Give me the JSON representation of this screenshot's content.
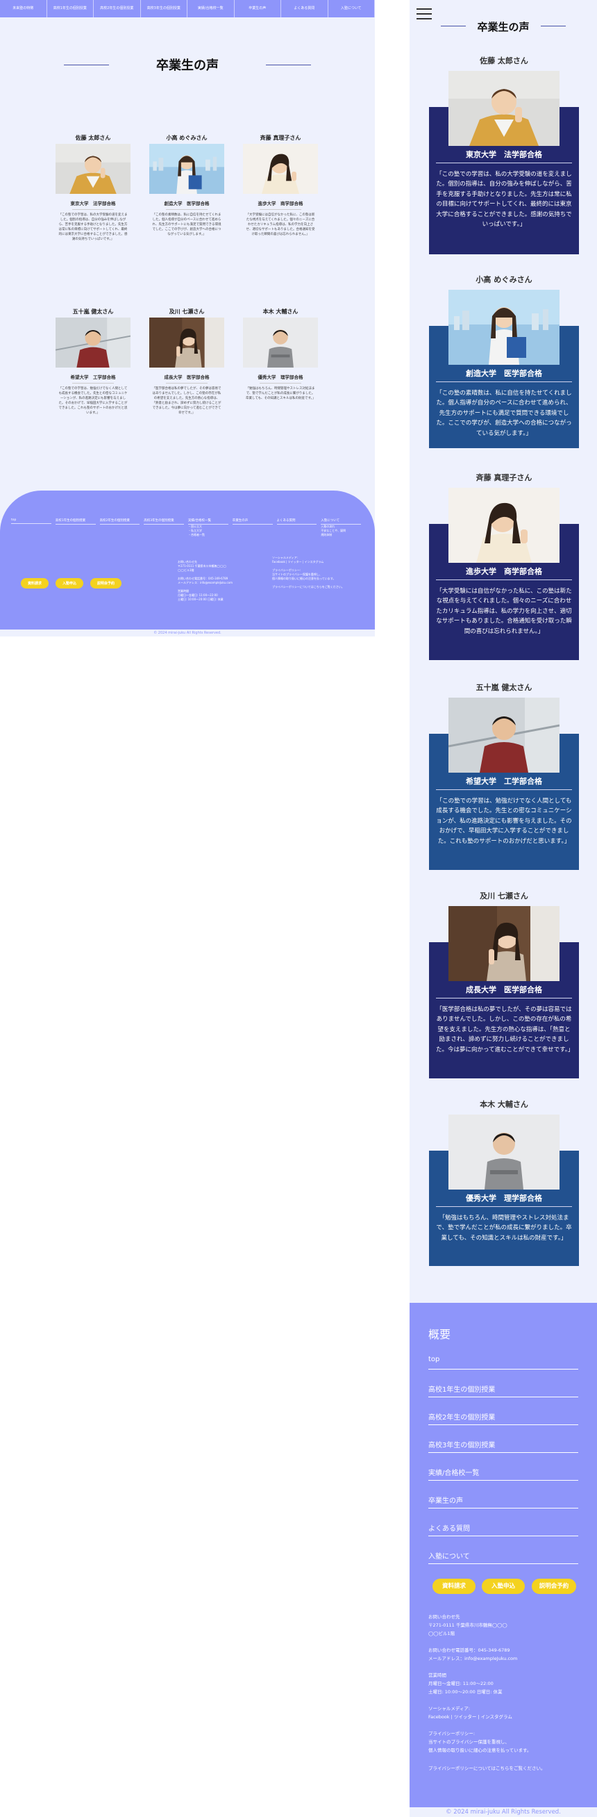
{
  "nav": {
    "items": [
      "未来塾の特徴",
      "高校1年生の個別授業",
      "高校2年生の個別授業",
      "高校3年生の個別授業",
      "実績/合格校一覧",
      "卒業生の声",
      "よくある質問",
      "入塾について"
    ]
  },
  "page_title": "卒業生の声",
  "testimonials": [
    {
      "name": "佐藤 太郎さん",
      "result": "東京大学　法学部合格",
      "text": "「この塾での学習は、私の大学受験の道を変えました。個別の指導は、自分の強みを伸ばしながら、苦手を克服する手助けとなりました。先生方は常に私の目標に向けてサポートしてくれ、最終的には東京大学に合格することができました。感謝の気持ちでいっぱいです。」",
      "photo": "student-1"
    },
    {
      "name": "小高 めぐみさん",
      "result": "創造大学　医学部合格",
      "text": "「この塾の素晴数は、私に自信を持たせてくれました。個人指導が自分のペースに合わせて進められ、先生方のサポートにも満足で質問できる環境でした。ここでの学びが、創造大学への合格につながっている気がします。」",
      "photo": "student-2"
    },
    {
      "name": "斉藤 真理子さん",
      "result": "進歩大学　商学部合格",
      "text": "「大学受験には自信がなかった私に、この塾は新たな視点を与えてくれました。個々のニーズに合わせたカリキュラム指導は、私の学力を向上させ、適切なサポートもありました。合格通知を受け取った瞬間の喜びは忘れられません。」",
      "photo": "student-3"
    },
    {
      "name": "五十嵐 健太さん",
      "result": "希望大学　工学部合格",
      "text": "「この塾での学習は、勉強だけでなく人間としても成長する機会でした。先生との密なコミュニケーションが、私の進路決定にも影響を与えました。そのおかげで、早稲田大学に入学することができました。これも塾のサポートのおかげだと思います。」",
      "photo": "student-4"
    },
    {
      "name": "及川 七瀬さん",
      "result": "成長大学　医学部合格",
      "text": "「医学部合格は私の夢でしたが、その夢は容易ではありませんでした。しかし、この塾の存在が私の希望を支えました。先生方の熱心な指導は、「熱意と励まされ、諦めずに努力し続けることができました。今は夢に向かって進むことができて幸せです。」",
      "photo": "student-5"
    },
    {
      "name": "本木 大輔さん",
      "result": "優秀大学　理学部合格",
      "text": "「勉強はもちろん、時間管理やストレス対処法まで、塾で学んだことが私の成長に繋がりました。卒業しても、その知識とスキルは私の財産です。」",
      "photo": "student-6"
    }
  ],
  "footer": {
    "heading": "概要",
    "links": [
      "top",
      "高校1年生の個別授業",
      "高校2年生の個別授業",
      "高校3年生の個別授業",
      "実績/合格校一覧",
      "卒業生の声",
      "よくある質問",
      "入塾について"
    ],
    "desktop_sublinks": [
      "・国公立大",
      "・私立大学",
      "・合格者一覧"
    ],
    "desktop_about_sub": [
      "入塾の流れ",
      "不安なことや、疑問",
      "規則体制"
    ],
    "buttons": [
      "資料請求",
      "入塾申込",
      "説明会予約"
    ],
    "info": {
      "contact_label": "お問い合わせ先",
      "address": "〒271-0111 千葉県市川市鶴無◯◯◯",
      "building": "◯◯ビル1階",
      "phone": "お問い合わせ電話番号：045-349-6789",
      "email": "メールアドレス：info@exampleJuku.com",
      "hours_label": "営業時間",
      "hours_weekday": "月曜日～金曜日: 11:00～22:00",
      "hours_saturday": "土曜日: 10:00～20:00 日曜日: 休業",
      "social_label": "ソーシャルメディア:",
      "social": "Facebook | ツイッター | インスタグラム",
      "privacy_label": "プライバシーポリシー:",
      "privacy_1": "当サイトのプライバシー保護を重視し、",
      "privacy_2": "個人情報の取り扱いに細心の注意を払っています。",
      "privacy_3": "プライバシーポリシーについてはこちらをご覧ください。"
    },
    "copyright": "© 2024 mirai-juku All Rights Reserved."
  },
  "colors": {
    "page_bg": "#eef1fd",
    "accent": "#8e95fa",
    "card_navy": "#23286e",
    "card_blue": "#22518f",
    "button_yellow": "#f4d21f"
  }
}
